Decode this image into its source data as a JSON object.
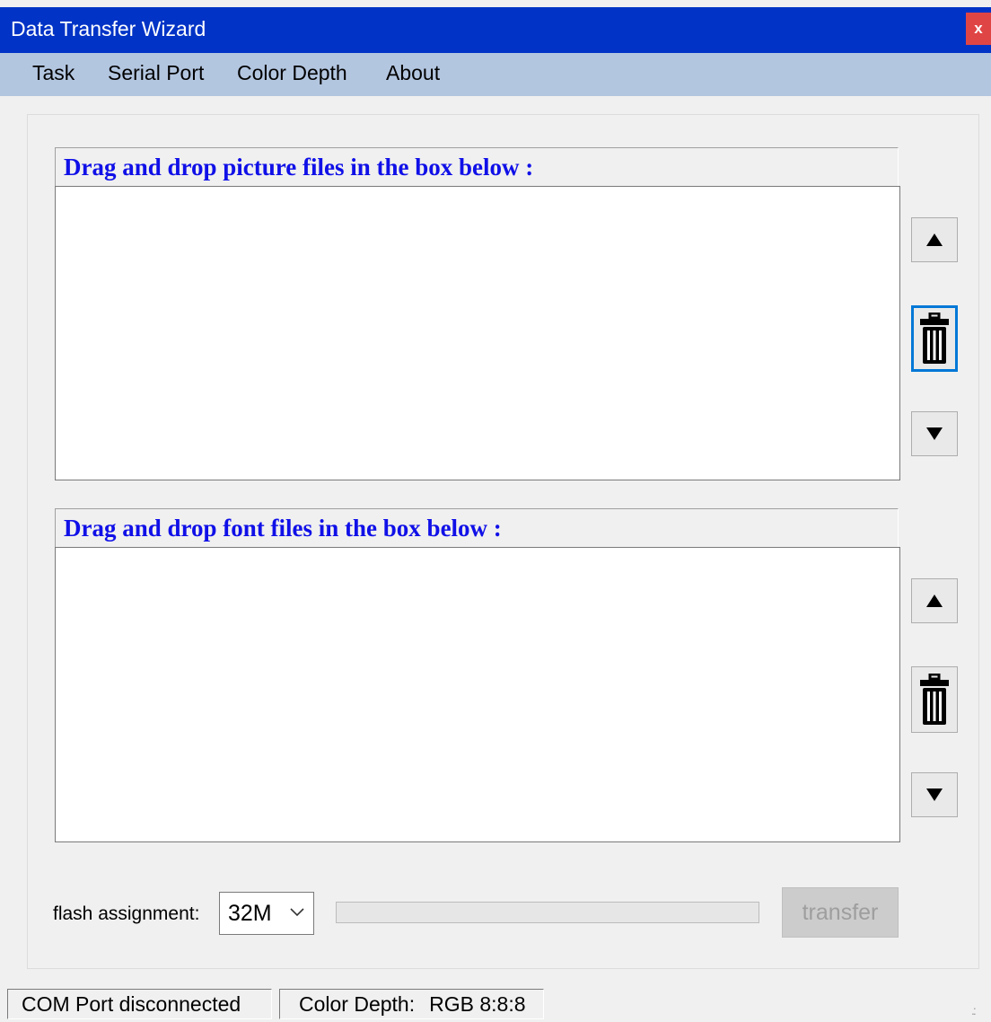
{
  "window": {
    "title": "Data Transfer Wizard",
    "close_label": "x"
  },
  "menu": {
    "items": [
      "Task",
      "Serial Port",
      "Color Depth",
      "About"
    ]
  },
  "pictures": {
    "label": "Drag and drop picture files in the box below :"
  },
  "fonts": {
    "label": "Drag and drop font files in the box below :"
  },
  "side_buttons": {
    "icons": [
      "arrow-up-icon",
      "trash-icon",
      "arrow-down-icon"
    ]
  },
  "flash": {
    "label": "flash assignment:",
    "value": "32M"
  },
  "transfer": {
    "label": "transfer",
    "progress": 0
  },
  "status": {
    "com": "COM Port  disconnected",
    "color_label": "Color Depth:",
    "color_value": "RGB 8:8:8"
  },
  "colors": {
    "titlebar": "#0033c6",
    "menubar": "#b3c6e0",
    "section_label": "#1010e8",
    "close": "#e04545",
    "focus": "#0078d7"
  }
}
